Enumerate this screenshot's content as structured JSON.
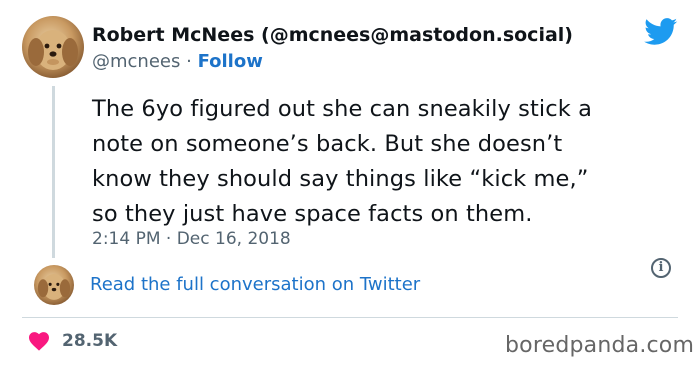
{
  "tweet": {
    "author_name": "Robert McNees (@mcnees@mastodon.social)",
    "handle": "@mcnees",
    "separator": "·",
    "follow_label": "Follow",
    "text_lines": [
      "The 6yo figured out she can sneakily stick a",
      "note on someone’s back. But she doesn’t",
      "know they should say things like “kick me,”",
      "so they just have space facts on them."
    ],
    "time": "2:14 PM",
    "date": "Dec 16, 2018",
    "read_more": "Read the full conversation on Twitter",
    "likes": "28.5K"
  },
  "icons": {
    "platform": "twitter-bird-icon",
    "info": "info-icon",
    "like": "heart-icon",
    "info_glyph": "i"
  },
  "watermark": "boredpanda.com",
  "colors": {
    "link": "#1d73c9",
    "twitter_blue": "#1d9bf0",
    "heart": "#f91880",
    "secondary_text": "#536471",
    "line": "#cfd9de"
  }
}
